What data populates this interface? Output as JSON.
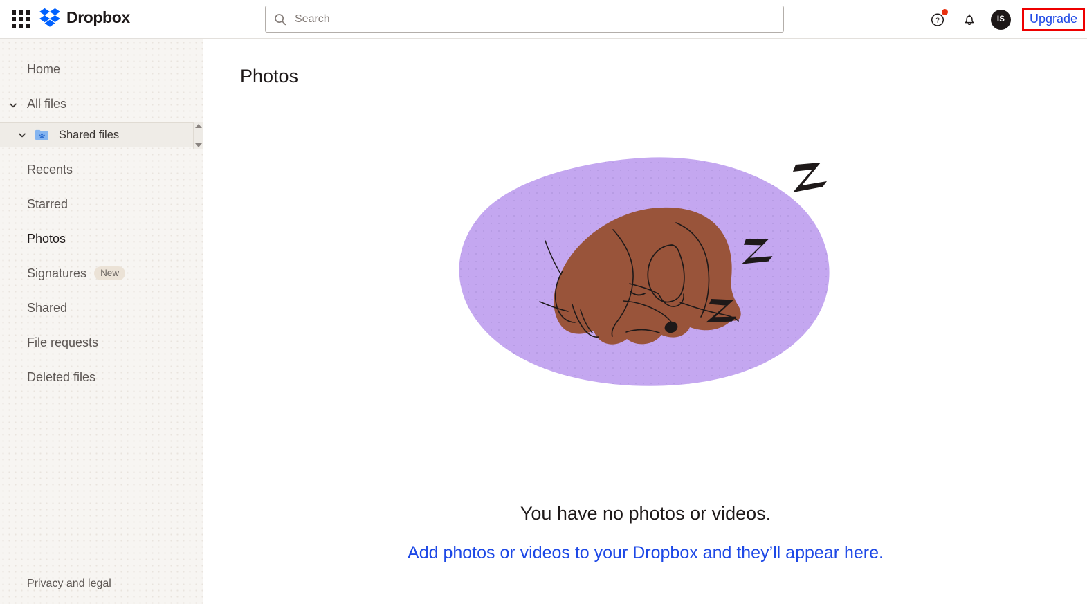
{
  "topbar": {
    "apps_icon": "apps-grid-icon",
    "brand_name": "Dropbox",
    "brand_logo_icon": "dropbox-logo-icon",
    "search": {
      "icon": "search-icon",
      "placeholder": "Search",
      "value": ""
    },
    "help_icon": "help-circle-icon",
    "notifications_icon": "bell-icon",
    "avatar_initials": "IS",
    "upgrade_label": "Upgrade",
    "upgrade_color": "#1d48e6",
    "highlight_color": "#ee0000",
    "notification_dot_color": "#e8300f"
  },
  "sidebar": {
    "items": [
      {
        "label": "Home",
        "chevron": false,
        "active": false
      },
      {
        "label": "All files",
        "chevron": true,
        "active": false
      },
      {
        "label": "Recents",
        "chevron": false,
        "active": false
      },
      {
        "label": "Starred",
        "chevron": false,
        "active": false
      },
      {
        "label": "Photos",
        "chevron": false,
        "active": true
      },
      {
        "label": "Signatures",
        "chevron": false,
        "active": false,
        "badge": "New"
      },
      {
        "label": "Shared",
        "chevron": false,
        "active": false
      },
      {
        "label": "File requests",
        "chevron": false,
        "active": false
      },
      {
        "label": "Deleted files",
        "chevron": false,
        "active": false
      }
    ],
    "shared_files_row": {
      "label": "Shared files",
      "folder_icon": "shared-folder-icon",
      "chevron_icon": "chevron-down-icon",
      "scroll_up_icon": "scroll-up-arrow-icon",
      "scroll_down_icon": "scroll-down-arrow-icon"
    },
    "footer_link": "Privacy and legal",
    "background_color": "#f7f5f2"
  },
  "main": {
    "page_title": "Photos",
    "illustration": {
      "name": "sleeping-dog-illustration",
      "blob_color": "#c4a7f0",
      "dog_color": "#99543a",
      "outline_color": "#1e1919",
      "zzz_marks": 3
    },
    "empty_title": "You have no photos or videos.",
    "empty_link": "Add photos or videos to your Dropbox and they’ll appear here."
  }
}
